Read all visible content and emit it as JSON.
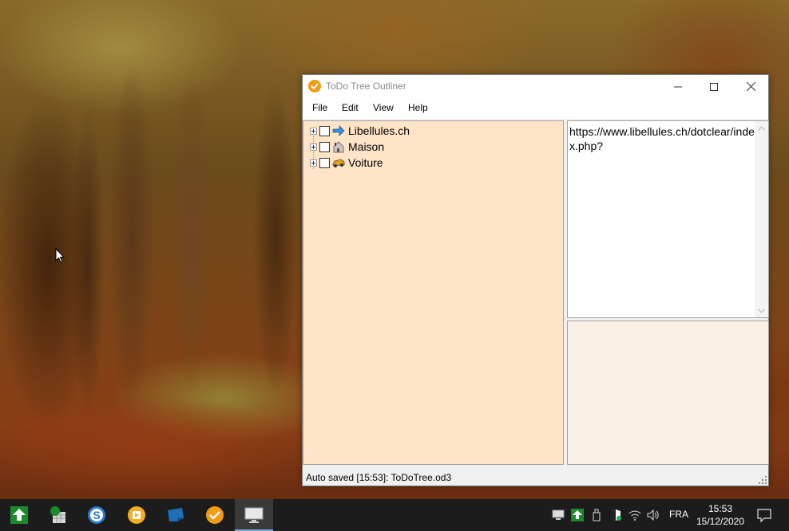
{
  "window": {
    "title": "ToDo Tree Outliner",
    "menu": [
      "File",
      "Edit",
      "View",
      "Help"
    ]
  },
  "tree": {
    "nodes": [
      {
        "label": "Libellules.ch",
        "icon": "arrow-right-icon",
        "checked": false
      },
      {
        "label": "Maison",
        "icon": "house-icon",
        "checked": false
      },
      {
        "label": "Voiture",
        "icon": "car-icon",
        "checked": false
      }
    ]
  },
  "note": {
    "text": "https://www.libellules.ch/dotclear/index.php?"
  },
  "status": {
    "text": "Auto saved [15:53]: ToDoTree.od3"
  },
  "taskbar": {
    "apps": [
      "upload-arrow-app",
      "spreadsheet-app",
      "s-circle-app",
      "media-player-app",
      "note-app",
      "todo-tree-app",
      "monitor-app"
    ],
    "language": "FRA",
    "time": "15:53",
    "date": "15/12/2020"
  },
  "colors": {
    "tree_bg": "#ffe4c8",
    "extra_bg": "#faf0e6",
    "accent": "#f39c12"
  }
}
